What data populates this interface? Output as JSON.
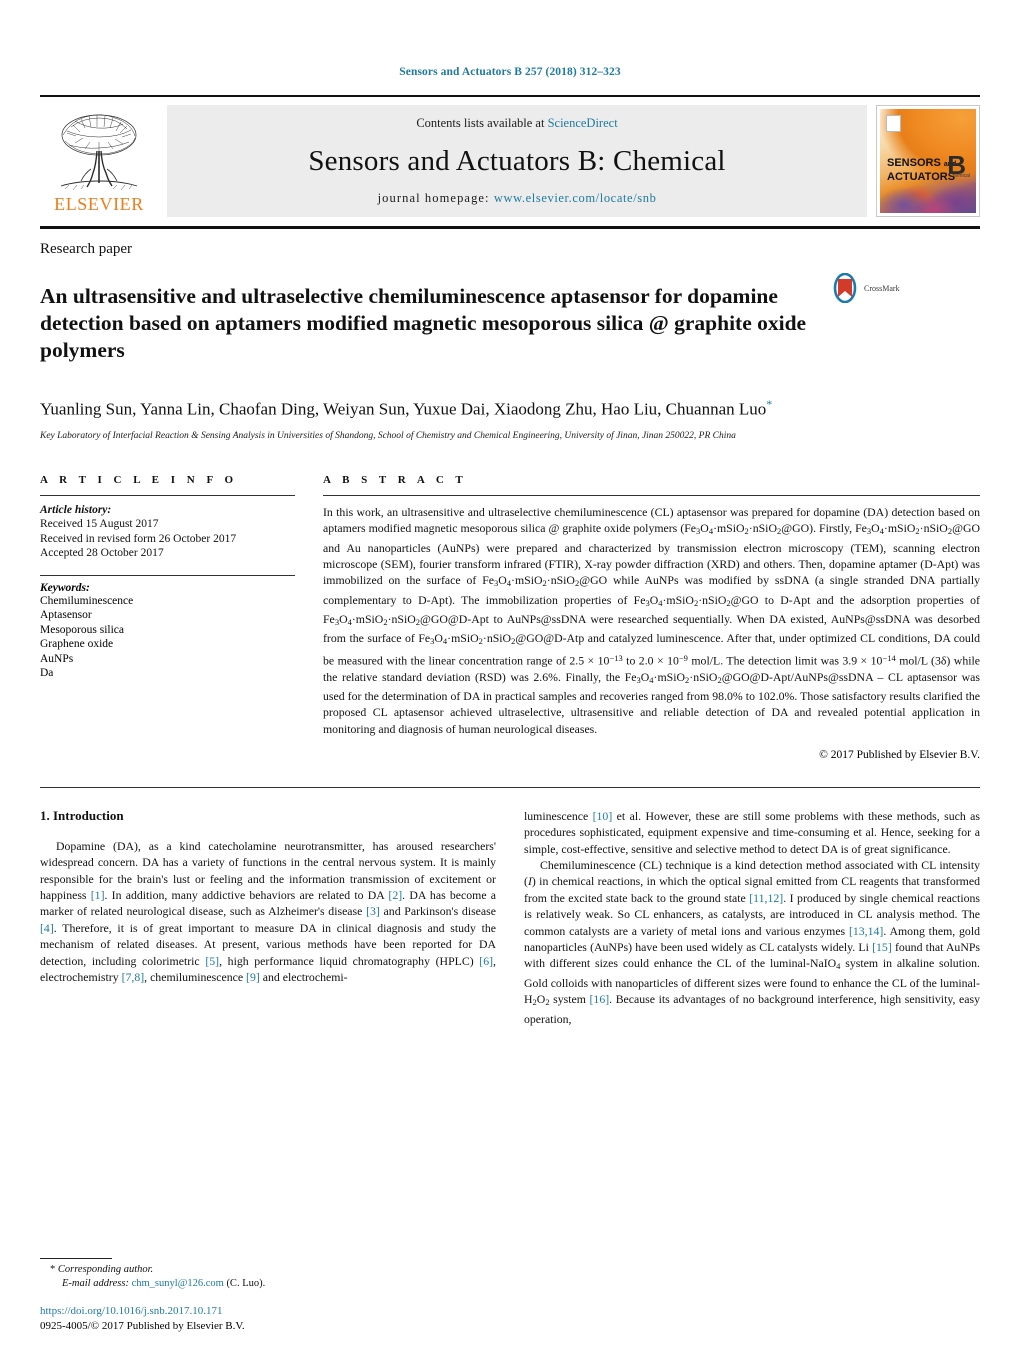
{
  "running_head": "Sensors and Actuators B 257 (2018) 312–323",
  "masthead": {
    "contents_prefix": "Contents lists available at ",
    "sciencedirect": "ScienceDirect",
    "journal_name": "Sensors and Actuators B: Chemical",
    "homepage_prefix": "journal homepage: ",
    "homepage_url": "www.elsevier.com/locate/snb",
    "publisher_wordmark": "ELSEVIER",
    "cover": {
      "line1": "SENSORS",
      "line1_small": "and",
      "line2": "ACTUATORS",
      "volume_letter": "B",
      "volume_sub": "Chemical"
    },
    "accent_color": "#1f7a9e",
    "elsevier_orange": "#ef7d1a"
  },
  "article": {
    "type": "Research paper",
    "title": "An ultrasensitive and ultraselective chemiluminescence aptasensor for dopamine detection based on aptamers modified magnetic mesoporous silica @ graphite oxide polymers",
    "crossmark_label": "CrossMark",
    "authors": "Yuanling Sun, Yanna Lin, Chaofan Ding, Weiyan Sun, Yuxue Dai, Xiaodong Zhu, Hao Liu, Chuannan Luo",
    "corresponding_marker": "*",
    "affiliation": "Key Laboratory of Interfacial Reaction & Sensing Analysis in Universities of Shandong, School of Chemistry and Chemical Engineering, University of Jinan, Jinan 250022, PR China"
  },
  "article_info": {
    "heading": "A R T I C L E   I N F O",
    "history_label": "Article history:",
    "history": [
      "Received 15 August 2017",
      "Received in revised form 26 October 2017",
      "Accepted 28 October 2017"
    ],
    "keywords_label": "Keywords:",
    "keywords": [
      "Chemiluminescence",
      "Aptasensor",
      "Mesoporous silica",
      "Graphene oxide",
      "AuNPs",
      "Da"
    ]
  },
  "abstract": {
    "heading": "A B S T R A C T",
    "paragraphs": [
      "In this work, an ultrasensitive and ultraselective chemiluminescence (CL) aptasensor was prepared for dopamine (DA) detection based on aptamers modified magnetic mesoporous silica @ graphite oxide polymers (Fe3O4·mSiO2·nSiO2@GO). Firstly, Fe3O4·mSiO2·nSiO2@GO and Au nanoparticles (AuNPs) were prepared and characterized by transmission electron microscopy (TEM), scanning electron microscope (SEM), fourier transform infrared (FTIR), X-ray powder diffraction (XRD) and others. Then, dopamine aptamer (D-Apt) was immobilized on the surface of Fe3O4·mSiO2·nSiO2@GO while AuNPs was modified by ssDNA (a single stranded DNA partially complementary to D-Apt). The immobilization properties of Fe3O4·mSiO2·nSiO2@GO to D-Apt and the adsorption properties of Fe3O4·mSiO2·nSiO2@GO@D-Apt to AuNPs@ssDNA were researched sequentially. When DA existed, AuNPs@ssDNA was desorbed from the surface of Fe3O4·mSiO2·nSiO2@GO@D-Atp and catalyzed luminescence. After that, under optimized CL conditions, DA could be measured with the linear concentration range of 2.5 × 10−13 to 2.0 × 10−9 mol/L. The detection limit was 3.9 × 10−14 mol/L (3δ) while the relative standard deviation (RSD) was 2.6%. Finally, the Fe3O4·mSiO2·nSiO2@GO@D-Apt/AuNPs@ssDNA – CL aptasensor was used for the determination of DA in practical samples and recoveries ranged from 98.0% to 102.0%. Those satisfactory results clarified the proposed CL aptasensor achieved ultraselective, ultrasensitive and reliable detection of DA and revealed potential application in monitoring and diagnosis of human neurological diseases."
    ],
    "copyright": "© 2017 Published by Elsevier B.V."
  },
  "introduction": {
    "heading": "1.  Introduction",
    "left_paragraphs": [
      "Dopamine (DA), as a kind catecholamine neurotransmitter, has aroused researchers' widespread concern. DA has a variety of functions in the central nervous system. It is mainly responsible for the brain's lust or feeling and the information transmission of excitement or happiness [1]. In addition, many addictive behaviors are related to DA [2]. DA has become a marker of related neurological disease, such as Alzheimer's disease [3] and Parkinson's disease [4]. Therefore, it is of great important to measure DA in clinical diagnosis and study the mechanism of related diseases. At present, various methods have been reported for DA detection, including colorimetric [5], high performance liquid chromatography (HPLC) [6], electrochemistry [7,8], chemiluminescence [9] and electrochemi-"
    ],
    "right_paragraphs": [
      "luminescence [10] et al. However, these are still some problems with these methods, such as procedures sophisticated, equipment expensive and time-consuming et al. Hence, seeking for a simple, cost-effective, sensitive and selective method to detect DA is of great significance.",
      "Chemiluminescence (CL) technique is a kind detection method associated with CL intensity (I) in chemical reactions, in which the optical signal emitted from CL reagents that transformed from the excited state back to the ground state [11,12]. I produced by single chemical reactions is relatively weak. So CL enhancers, as catalysts, are introduced in CL analysis method. The common catalysts are a variety of metal ions and various enzymes [13,14]. Among them, gold nanoparticles (AuNPs) have been used widely as CL catalysts widely. Li [15] found that AuNPs with different sizes could enhance the CL of the luminal-NaIO4 system in alkaline solution. Gold colloids with nanoparticles of different sizes were found to enhance the CL of the luminal-H2O2 system [16]. Because its advantages of no background interference, high sensitivity, easy operation,"
    ]
  },
  "footer": {
    "corresponding_marker": "*",
    "corresponding_label": "Corresponding author.",
    "email_label": "E-mail address:",
    "email": "chm_sunyl@126.com",
    "email_suffix": "(C. Luo).",
    "doi": "https://doi.org/10.1016/j.snb.2017.10.171",
    "issn_line": "0925-4005/© 2017 Published by Elsevier B.V."
  }
}
